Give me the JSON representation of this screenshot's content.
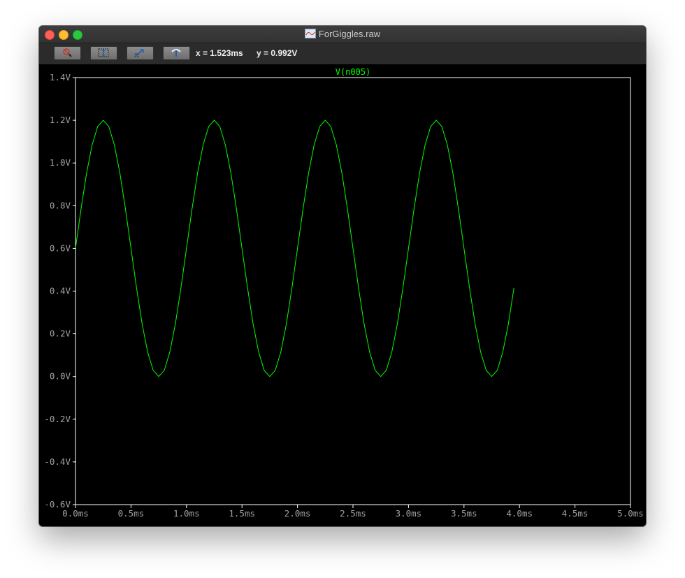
{
  "window": {
    "title": "ForGiggles.raw",
    "readout_x": "x = 1.523ms",
    "readout_y": "y = 0.992V"
  },
  "toolbar": {
    "buttons": [
      "zoom-out-icon",
      "autorange-icon",
      "pan-icon",
      "cursor-icon"
    ]
  },
  "colors": {
    "trace": "#00ff00",
    "axes": "#ffffff",
    "background": "#000000",
    "label_text": "#a0a0a0"
  },
  "chart_data": {
    "type": "line",
    "title": "V(n005)",
    "xlabel": "",
    "ylabel": "",
    "xlim": [
      0,
      5
    ],
    "ylim": [
      -0.6,
      1.4
    ],
    "x_ticks": [
      "0.0ms",
      "0.5ms",
      "1.0ms",
      "1.5ms",
      "2.0ms",
      "2.5ms",
      "3.0ms",
      "3.5ms",
      "4.0ms",
      "4.5ms",
      "5.0ms"
    ],
    "y_ticks": [
      "1.4V",
      "1.2V",
      "1.0V",
      "0.8V",
      "0.6V",
      "0.4V",
      "0.2V",
      "0.0V",
      "-0.2V",
      "-0.4V",
      "-0.6V"
    ],
    "grid": false,
    "series": [
      {
        "name": "V(n005)",
        "x": [
          0,
          0.05,
          0.1,
          0.15,
          0.2,
          0.25,
          0.3,
          0.35,
          0.4,
          0.45,
          0.5,
          0.55,
          0.6,
          0.65,
          0.7,
          0.75,
          0.8,
          0.85,
          0.9,
          0.95,
          1.0,
          1.05,
          1.1,
          1.15,
          1.2,
          1.25,
          1.3,
          1.35,
          1.4,
          1.45,
          1.5,
          1.55,
          1.6,
          1.65,
          1.7,
          1.75,
          1.8,
          1.85,
          1.9,
          1.95,
          2.0,
          2.05,
          2.1,
          2.15,
          2.2,
          2.25,
          2.3,
          2.35,
          2.4,
          2.45,
          2.5,
          2.55,
          2.6,
          2.65,
          2.7,
          2.75,
          2.8,
          2.85,
          2.9,
          2.95,
          3.0,
          3.05,
          3.1,
          3.15,
          3.2,
          3.25,
          3.3,
          3.35,
          3.4,
          3.45,
          3.5,
          3.55,
          3.6,
          3.65,
          3.7,
          3.75,
          3.8,
          3.85,
          3.9,
          3.95
        ],
        "y": [
          0.6,
          0.785,
          0.953,
          1.085,
          1.171,
          1.2,
          1.171,
          1.085,
          0.953,
          0.785,
          0.6,
          0.415,
          0.247,
          0.115,
          0.029,
          0.0,
          0.029,
          0.115,
          0.247,
          0.415,
          0.6,
          0.785,
          0.953,
          1.085,
          1.171,
          1.2,
          1.171,
          1.085,
          0.953,
          0.785,
          0.6,
          0.415,
          0.247,
          0.115,
          0.029,
          0.0,
          0.029,
          0.115,
          0.247,
          0.415,
          0.6,
          0.785,
          0.953,
          1.085,
          1.171,
          1.2,
          1.171,
          1.085,
          0.953,
          0.785,
          0.6,
          0.415,
          0.247,
          0.115,
          0.029,
          0.0,
          0.029,
          0.115,
          0.247,
          0.415,
          0.6,
          0.785,
          0.953,
          1.085,
          1.171,
          1.2,
          1.171,
          1.085,
          0.953,
          0.785,
          0.6,
          0.415,
          0.247,
          0.115,
          0.029,
          0.0,
          0.029,
          0.115,
          0.247,
          0.415
        ]
      }
    ]
  }
}
